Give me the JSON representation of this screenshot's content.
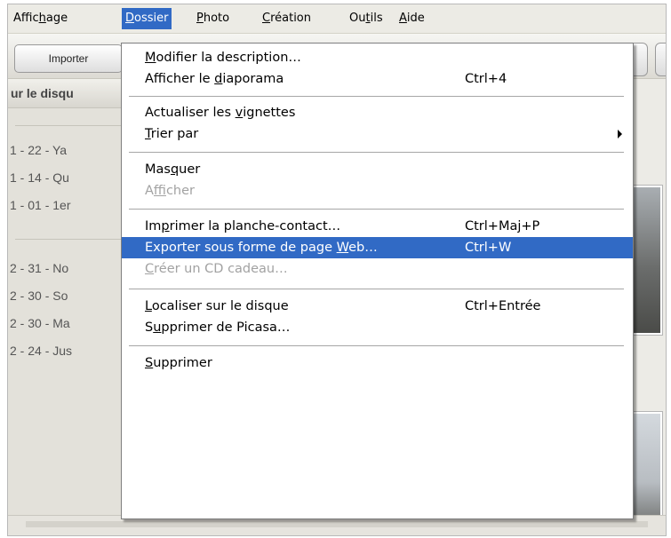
{
  "menubar": {
    "items": [
      {
        "pre": "Affic",
        "ul": "h",
        "post": "age"
      },
      {
        "pre": "",
        "ul": "D",
        "post": "ossier"
      },
      {
        "pre": "",
        "ul": "P",
        "post": "hoto"
      },
      {
        "pre": "",
        "ul": "C",
        "post": "réation"
      },
      {
        "pre": "Ou",
        "ul": "t",
        "post": "ils"
      },
      {
        "pre": "",
        "ul": "A",
        "post": "ide"
      }
    ],
    "active_index": 1
  },
  "toolbar": {
    "import_label": "Importer"
  },
  "left_panel": {
    "header": "ur le disqu",
    "folders_group1": [
      "1 - 22 - Ya",
      "1 - 14 - Qu",
      "1 - 01 - 1er"
    ],
    "folders_group2": [
      "2 - 31 - No",
      "2 - 30 - So",
      "2 - 30 - Ma",
      "2 - 24 - Jus"
    ]
  },
  "dossier_menu": {
    "items": [
      {
        "pre": "",
        "ul": "M",
        "post": "odifier la description…",
        "shortcut": "",
        "state": "normal"
      },
      {
        "pre": "Afficher le ",
        "ul": "d",
        "post": "iaporama",
        "shortcut": "Ctrl+4",
        "state": "normal"
      },
      {
        "separator": true
      },
      {
        "pre": "Actualiser les ",
        "ul": "v",
        "post": "ignettes",
        "shortcut": "",
        "state": "normal"
      },
      {
        "pre": "",
        "ul": "T",
        "post": "rier par",
        "shortcut": "",
        "state": "normal",
        "submenu": true
      },
      {
        "separator": true
      },
      {
        "pre": "Mas",
        "ul": "q",
        "post": "uer",
        "shortcut": "",
        "state": "normal"
      },
      {
        "pre": "A",
        "ul": "f",
        "post": "ficher",
        "shortcut": "",
        "state": "disabled"
      },
      {
        "separator": true
      },
      {
        "pre": "Im",
        "ul": "p",
        "post": "rimer la planche-contact…",
        "shortcut": "Ctrl+Maj+P",
        "state": "normal"
      },
      {
        "pre": "Exporter sous forme de page ",
        "ul": "W",
        "post": "eb…",
        "shortcut": "Ctrl+W",
        "state": "highlighted"
      },
      {
        "pre": "",
        "ul": "C",
        "post": "réer un CD cadeau…",
        "shortcut": "",
        "state": "disabled"
      },
      {
        "separator": true
      },
      {
        "pre": "",
        "ul": "L",
        "post": "ocaliser sur le disque",
        "shortcut": "Ctrl+Entrée",
        "state": "normal"
      },
      {
        "pre": "S",
        "ul": "u",
        "post": "pprimer de Picasa…",
        "shortcut": "",
        "state": "normal"
      },
      {
        "separator": true
      },
      {
        "pre": "",
        "ul": "S",
        "post": "upprimer",
        "shortcut": "",
        "state": "normal"
      }
    ]
  },
  "colors": {
    "highlight": "#316ac5",
    "menubar_bg": "#ecebe5",
    "disabled_text": "#a2a2a2"
  }
}
